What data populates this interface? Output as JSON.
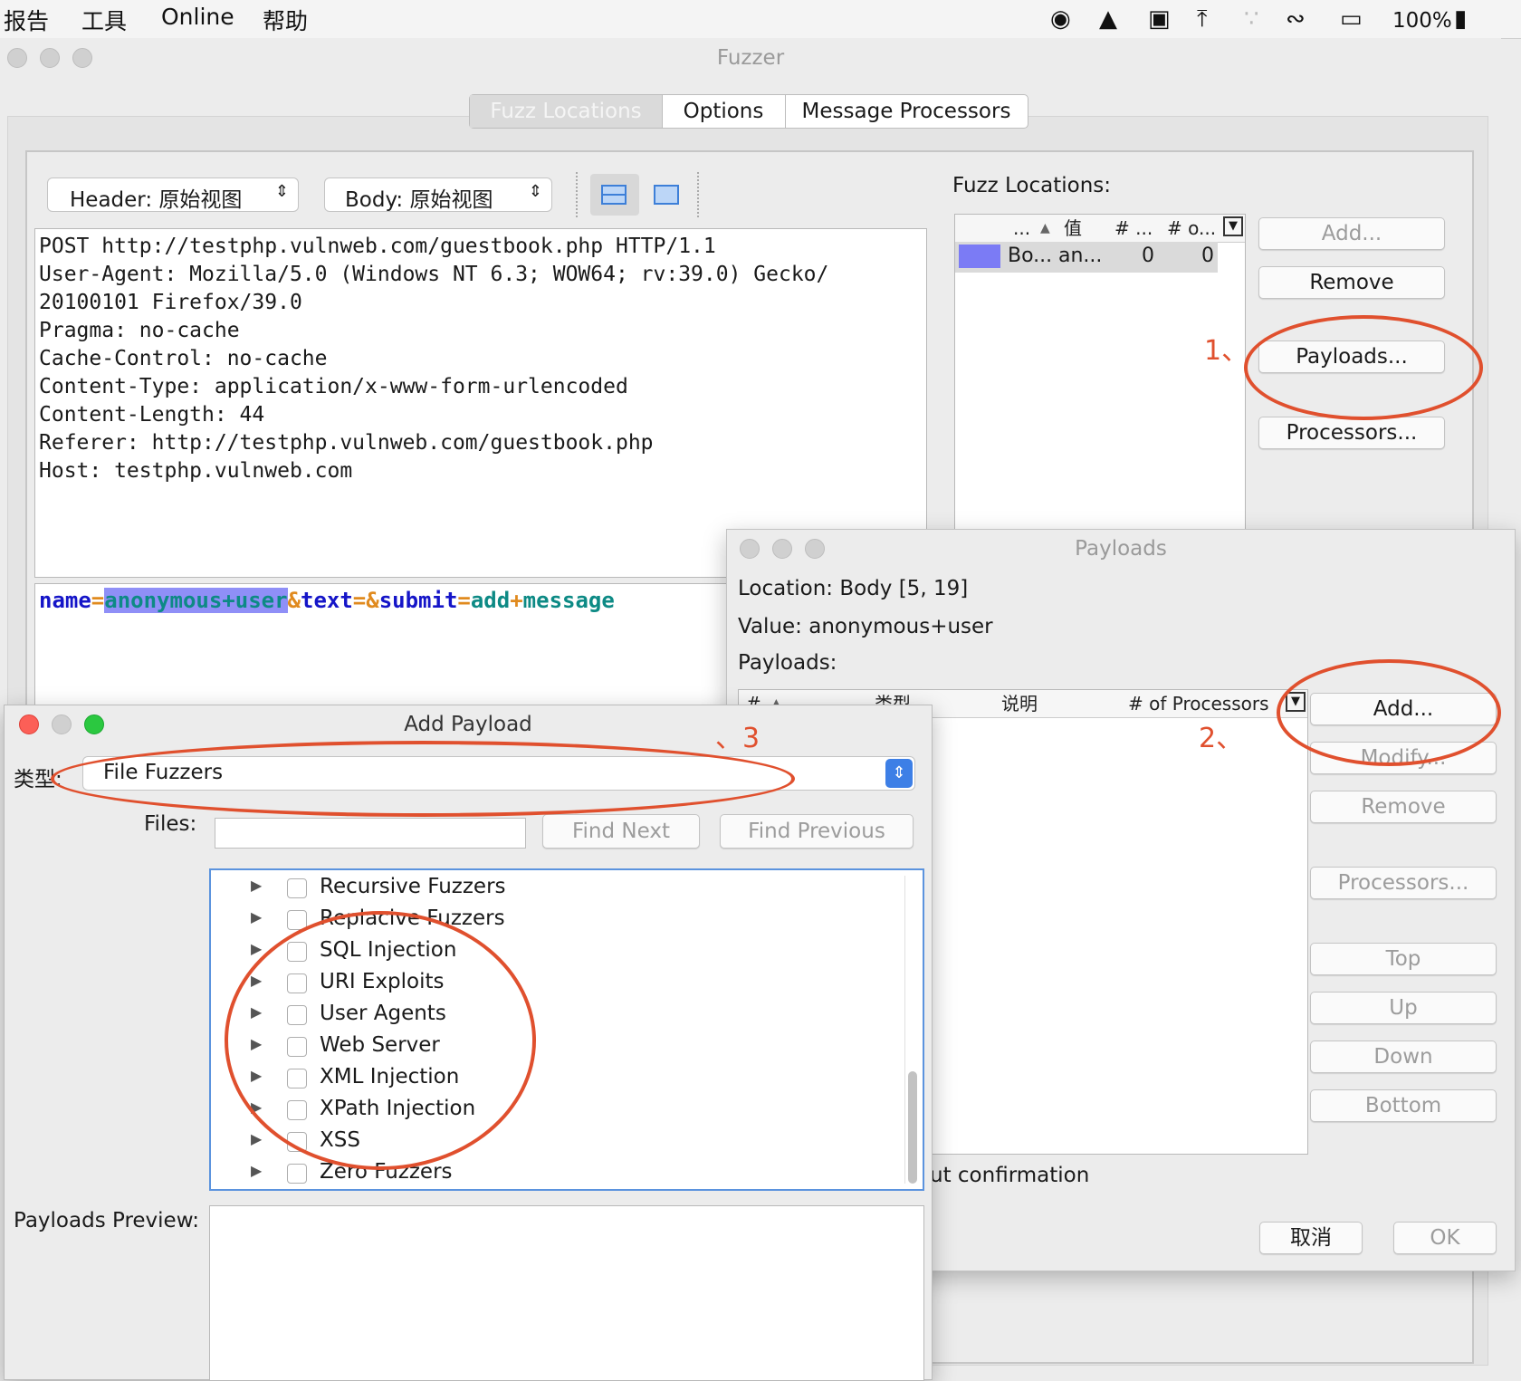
{
  "menubar": {
    "items": [
      "报告",
      "工具",
      "Online",
      "帮助"
    ],
    "battery": "100%"
  },
  "fuzzer": {
    "title": "Fuzzer",
    "tabs": [
      "Fuzz Locations",
      "Options",
      "Message Processors"
    ],
    "header_select": "Header: 原始视图",
    "body_select": "Body: 原始视图",
    "request_lines": [
      "POST http://testphp.vulnweb.com/guestbook.php HTTP/1.1",
      "User-Agent: Mozilla/5.0 (Windows NT 6.3; WOW64; rv:39.0) Gecko/",
      "20100101 Firefox/39.0",
      "Pragma: no-cache",
      "Cache-Control: no-cache",
      "Content-Type: application/x-www-form-urlencoded",
      "Content-Length: 44",
      "Referer: http://testphp.vulnweb.com/guestbook.php",
      "Host: testphp.vulnweb.com"
    ],
    "body": {
      "k1": "name",
      "eq": "=",
      "v1": "anonymous+user",
      "amp": "&",
      "k2": "text",
      "k3": "submit",
      "v3a": "add",
      "plus": "+",
      "v3b": "message"
    },
    "locations_label": "Fuzz Locations:",
    "loc_headers": [
      "...",
      "值",
      "# ...",
      "# o..."
    ],
    "loc_row": [
      "Bo...",
      "an...",
      "0",
      "0"
    ],
    "buttons": {
      "add": "Add...",
      "remove": "Remove",
      "payloads": "Payloads...",
      "processors": "Processors..."
    }
  },
  "payloads_dialog": {
    "title": "Payloads",
    "location": "Location:  Body [5, 19]",
    "value": "Value:  anonymous+user",
    "payloads_label": "Payloads:",
    "headers": [
      "#",
      "类型",
      "说明",
      "# of Processors"
    ],
    "buttons": {
      "add": "Add...",
      "modify": "Modify...",
      "remove": "Remove",
      "processors": "Processors...",
      "top": "Top",
      "up": "Up",
      "down": "Down",
      "bottom": "Bottom",
      "cancel": "取消",
      "ok": "OK"
    },
    "confirmation_text": "ut confirmation"
  },
  "add_payload": {
    "title": "Add Payload",
    "type_label": "类型:",
    "type_value": "File Fuzzers",
    "files_label": "Files:",
    "find_next": "Find Next",
    "find_previous": "Find Previous",
    "tree": [
      "Recursive Fuzzers",
      "Replacive Fuzzers",
      "SQL Injection",
      "URI Exploits",
      "User Agents",
      "Web Server",
      "XML Injection",
      "XPath Injection",
      "XSS",
      "Zero Fuzzers"
    ],
    "preview_label": "Payloads Preview:"
  },
  "annotations": {
    "a1": "1、",
    "a2": "2、",
    "a3": "、3"
  },
  "colors": {
    "accent": "#e0502e",
    "selection": "#7b7bf5",
    "keyword": "#1515c8",
    "value": "#0d8a85"
  }
}
